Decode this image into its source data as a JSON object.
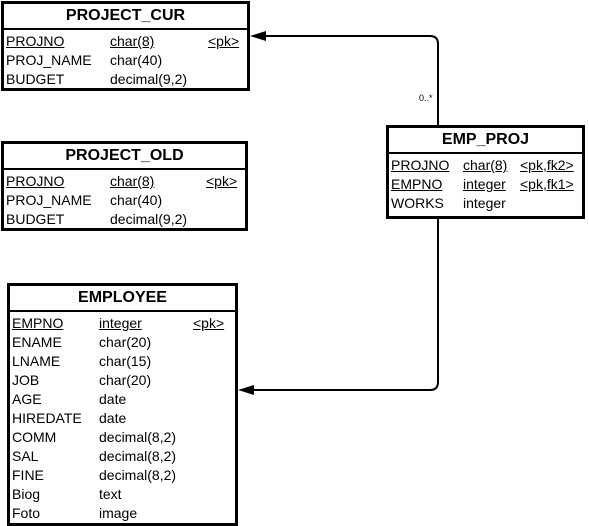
{
  "entities": {
    "project_cur": {
      "title": "PROJECT_CUR",
      "columns": [
        {
          "name": "PROJNO",
          "type": "char(8)",
          "key": "<pk>",
          "underline": true
        },
        {
          "name": "PROJ_NAME",
          "type": "char(40)",
          "key": ""
        },
        {
          "name": "BUDGET",
          "type": "decimal(9,2)",
          "key": ""
        }
      ]
    },
    "project_old": {
      "title": "PROJECT_OLD",
      "columns": [
        {
          "name": "PROJNO",
          "type": "char(8)",
          "key": "<pk>",
          "underline": true
        },
        {
          "name": "PROJ_NAME",
          "type": "char(40)",
          "key": ""
        },
        {
          "name": "BUDGET",
          "type": "decimal(9,2)",
          "key": ""
        }
      ]
    },
    "emp_proj": {
      "title": "EMP_PROJ",
      "columns": [
        {
          "name": "PROJNO",
          "type": "char(8)",
          "key": "<pk,fk2>",
          "underline": true
        },
        {
          "name": "EMPNO",
          "type": "integer",
          "key": "<pk,fk1>",
          "underline": true
        },
        {
          "name": "WORKS",
          "type": "integer",
          "key": ""
        }
      ]
    },
    "employee": {
      "title": "EMPLOYEE",
      "columns": [
        {
          "name": "EMPNO",
          "type": "integer",
          "key": "<pk>",
          "underline": true
        },
        {
          "name": "ENAME",
          "type": "char(20)",
          "key": ""
        },
        {
          "name": "LNAME",
          "type": "char(15)",
          "key": ""
        },
        {
          "name": "JOB",
          "type": "char(20)",
          "key": ""
        },
        {
          "name": "AGE",
          "type": "date",
          "key": ""
        },
        {
          "name": "HIREDATE",
          "type": "date",
          "key": ""
        },
        {
          "name": "COMM",
          "type": "decimal(8,2)",
          "key": ""
        },
        {
          "name": "SAL",
          "type": "decimal(8,2)",
          "key": ""
        },
        {
          "name": "FINE",
          "type": "decimal(8,2)",
          "key": ""
        },
        {
          "name": "Biog",
          "type": "text",
          "key": ""
        },
        {
          "name": "Foto",
          "type": "image",
          "key": ""
        }
      ]
    }
  },
  "relationships": [
    {
      "from": "EMP_PROJ",
      "to": "PROJECT_CUR",
      "cardinality": "0..*"
    },
    {
      "from": "EMP_PROJ",
      "to": "EMPLOYEE",
      "cardinality": ""
    }
  ]
}
